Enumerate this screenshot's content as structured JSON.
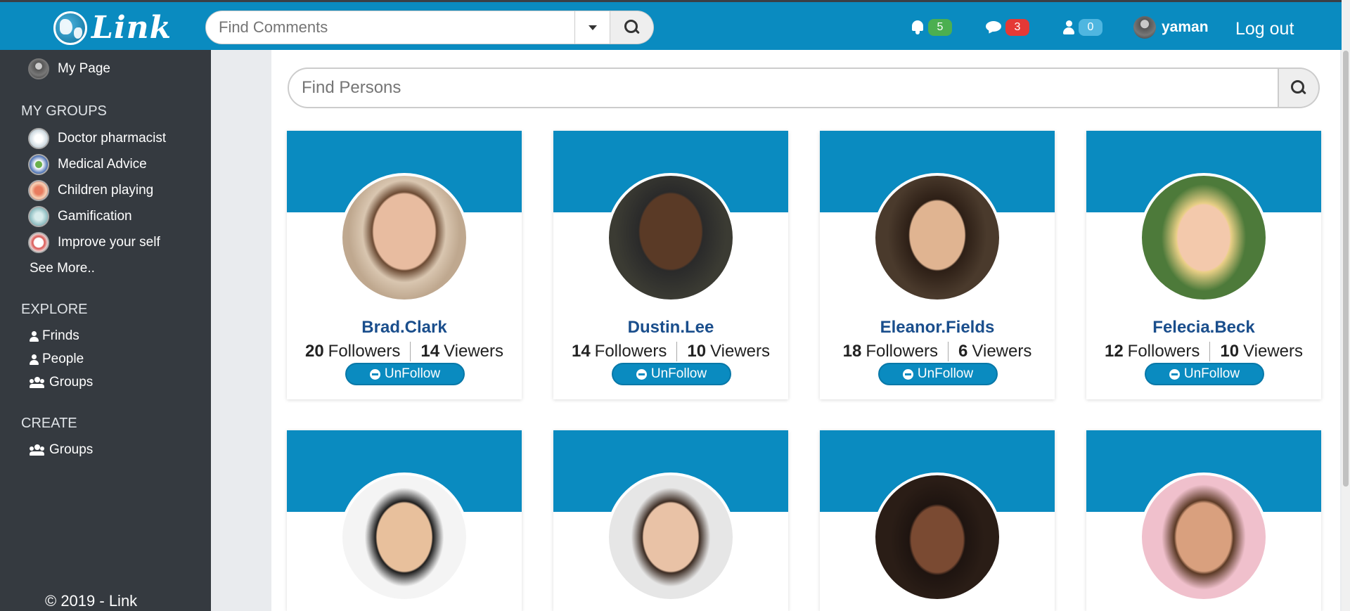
{
  "app": {
    "logo_text": "Link"
  },
  "topbar": {
    "search_placeholder": "Find Comments",
    "notifications": {
      "bell": "5",
      "messages": "3",
      "requests": "0"
    },
    "user": {
      "name": "yaman"
    },
    "logout": "Log out"
  },
  "sidebar": {
    "my_page": "My Page",
    "groups_heading": "MY GROUPS",
    "groups": [
      {
        "label": "Doctor pharmacist"
      },
      {
        "label": "Medical Advice"
      },
      {
        "label": "Children playing"
      },
      {
        "label": "Gamification"
      },
      {
        "label": "Improve your self"
      }
    ],
    "see_more": "See More..",
    "explore_heading": "EXPLORE",
    "explore": [
      "Frinds",
      "People",
      "Groups"
    ],
    "create_heading": "CREATE",
    "create": [
      "Groups"
    ],
    "copyright": "© 2019 - Link"
  },
  "main": {
    "search_placeholder": "Find Persons",
    "followers_label": "Followers",
    "viewers_label": "Viewers",
    "unfollow_label": "UnFollow",
    "people": [
      {
        "name": "Brad.Clark",
        "followers": "20",
        "viewers": "14"
      },
      {
        "name": "Dustin.Lee",
        "followers": "14",
        "viewers": "10"
      },
      {
        "name": "Eleanor.Fields",
        "followers": "18",
        "viewers": "6"
      },
      {
        "name": "Felecia.Beck",
        "followers": "12",
        "viewers": "10"
      }
    ]
  },
  "colors": {
    "brand": "#0a8bc0",
    "sidebar": "#353a40",
    "badge_green": "#4caf50",
    "badge_red": "#e53935",
    "badge_blue": "#4fb6e0",
    "name_link": "#1a4e8c"
  }
}
